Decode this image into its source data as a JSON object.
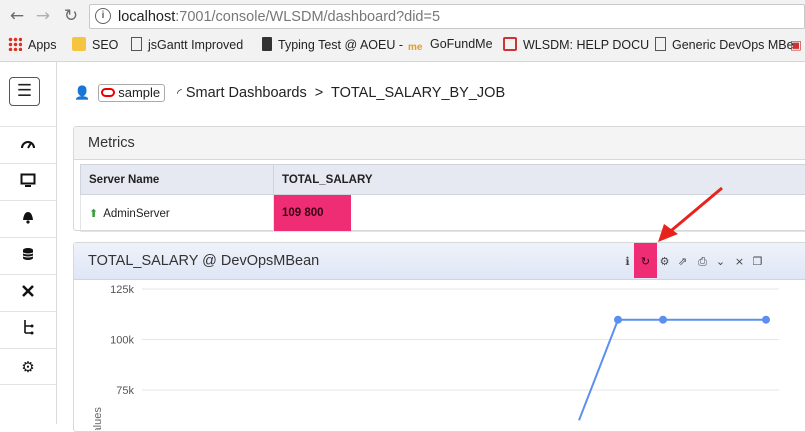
{
  "browser": {
    "url_host": "localhost",
    "url_rest": ":7001/console/WLSDM/dashboard?did=5",
    "bookmarks": [
      {
        "label": "Apps",
        "icon": "apps-grid-icon"
      },
      {
        "label": "SEO",
        "icon": "folder-icon"
      },
      {
        "label": "jsGantt Improved",
        "icon": "page-icon"
      },
      {
        "label": "Typing Test @ AOEU -",
        "icon": "hammer-icon"
      },
      {
        "label": "GoFundMe",
        "icon": "gofundme-icon"
      },
      {
        "label": "WLSDM: HELP DOCU",
        "icon": "wlsdm-icon"
      },
      {
        "label": "Generic DevOps MBe",
        "icon": "page-icon"
      }
    ]
  },
  "sidebar": {
    "items": [
      {
        "name": "dashboard-gauge-icon",
        "glyph": "◠"
      },
      {
        "name": "monitor-icon",
        "glyph": "▭"
      },
      {
        "name": "alert-bell-icon",
        "glyph": "🔔"
      },
      {
        "name": "database-icon",
        "glyph": "≣"
      },
      {
        "name": "tools-icon",
        "glyph": "✕"
      },
      {
        "name": "diagram-icon",
        "glyph": "⊢"
      },
      {
        "name": "settings-gear-icon",
        "glyph": "⚙"
      }
    ]
  },
  "breadcrumb": {
    "domain": "sample",
    "section": "Smart Dashboards",
    "separator": ">",
    "page": "TOTAL_SALARY_BY_JOB"
  },
  "metrics": {
    "title": "Metrics",
    "columns": [
      "Server Name",
      "TOTAL_SALARY"
    ],
    "rows": [
      {
        "server": "AdminServer",
        "total_salary": "109 800",
        "status": "up"
      }
    ]
  },
  "chart_panel": {
    "title": "TOTAL_SALARY @ DevOpsMBean",
    "toolbar": [
      "info-icon",
      "refresh-icon",
      "settings-gear-icon",
      "export-icon",
      "print-icon",
      "collapse-chevron-icon",
      "close-icon",
      "maximize-icon"
    ]
  },
  "chart_data": {
    "type": "line",
    "ylabel": "Values",
    "yticks": [
      "125k",
      "100k",
      "75k"
    ],
    "ylim": [
      60000,
      125000
    ],
    "series": [
      {
        "values": [
          109800,
          109800,
          109800
        ],
        "point_x_index": [
          1,
          2,
          3
        ]
      }
    ],
    "line_from_value": 60000,
    "color": "#5b8ff0"
  },
  "colors": {
    "highlight": "#ef2d75",
    "annotation_arrow": "#e8231e"
  }
}
